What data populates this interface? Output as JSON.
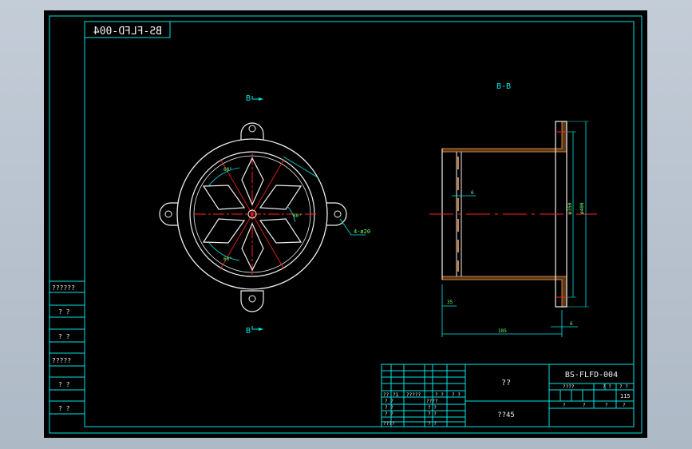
{
  "drawing": {
    "code_mirrored": "BS-FLFD-004",
    "section_label": "B-B",
    "section_marker": "B",
    "hole_note": "4-ø20",
    "angle_marks": [
      "60°",
      "60°",
      "60°"
    ],
    "dim_left_bottom": "35",
    "dim_total": "185",
    "dim_right": "6",
    "dim_dia_1": "ø350",
    "dim_dia_2": "ø400",
    "dim_small": "6"
  },
  "side_table": {
    "labels": [
      "??????",
      "? ?",
      "? ?",
      "?????",
      "? ?",
      "? ?"
    ]
  },
  "title_block": {
    "drawing_code": "BS-FLFD-004",
    "name": "??",
    "material": "??45",
    "right_headers": [
      "????",
      "? ?",
      "? ?"
    ],
    "scale": "115",
    "right_bottom": [
      "?",
      "?",
      "?",
      "?"
    ],
    "left_rows": [
      [
        "??",
        "?1",
        "?????",
        "? ?",
        "? ?"
      ],
      [
        "? ?",
        "",
        "????",
        "",
        ""
      ],
      [
        "? ?",
        "",
        "? ?",
        "",
        ""
      ],
      [
        "? ?",
        "",
        "? ?",
        "",
        ""
      ],
      [
        "????",
        "",
        "? ?",
        "",
        ""
      ]
    ]
  },
  "colors": {
    "background": "#000000",
    "frame": "#00e5e5",
    "outline": "#f0f0f0",
    "centerline": "#ff2020",
    "dimension": "#00e5e5",
    "section_hatch": "#d08040"
  }
}
